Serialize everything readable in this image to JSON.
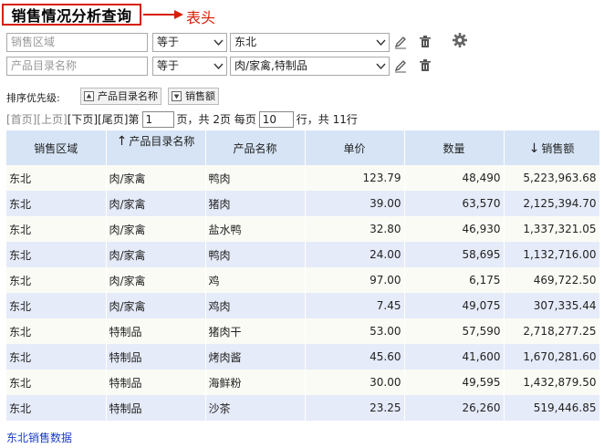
{
  "title": "销售情况分析查询",
  "annotation": {
    "label": "表头",
    "color": "#d81e06"
  },
  "filters": [
    {
      "field_placeholder": "销售区域",
      "operator": "等于",
      "value": "东北"
    },
    {
      "field_placeholder": "产品目录名称",
      "operator": "等于",
      "value": "肉/家禽,特制品"
    }
  ],
  "icons": {
    "edit": "pencil-icon",
    "delete": "trash-icon",
    "settings": "gear-icon"
  },
  "sort": {
    "label": "排序优先级:",
    "buttons": [
      {
        "label": "产品目录名称",
        "direction": "up"
      },
      {
        "label": "销售额",
        "direction": "down"
      }
    ]
  },
  "pager": {
    "first": "[首页]",
    "prev": "[上页]",
    "next": "[下页]",
    "last": "[尾页]",
    "page_prefix": "第",
    "current_page": "1",
    "page_mid": "页，共 2页 每页",
    "page_size": "10",
    "rows_suffix": "行，共 11行"
  },
  "table": {
    "columns": [
      "销售区域",
      "产品目录名称",
      "产品名称",
      "单价",
      "数量",
      "销售额"
    ],
    "sort_arrows": {
      "产品目录名称": "↑",
      "销售额": "↓"
    },
    "rows": [
      [
        "东北",
        "肉/家禽",
        "鸭肉",
        "123.79",
        "48,490",
        "5,223,963.68"
      ],
      [
        "东北",
        "肉/家禽",
        "猪肉",
        "39.00",
        "63,570",
        "2,125,394.70"
      ],
      [
        "东北",
        "肉/家禽",
        "盐水鸭",
        "32.80",
        "46,930",
        "1,337,321.05"
      ],
      [
        "东北",
        "肉/家禽",
        "鸭肉",
        "24.00",
        "58,695",
        "1,132,716.00"
      ],
      [
        "东北",
        "肉/家禽",
        "鸡",
        "97.00",
        "6,175",
        "469,722.50"
      ],
      [
        "东北",
        "肉/家禽",
        "鸡肉",
        "7.45",
        "49,075",
        "307,335.44"
      ],
      [
        "东北",
        "特制品",
        "猪肉干",
        "53.00",
        "57,590",
        "2,718,277.25"
      ],
      [
        "东北",
        "特制品",
        "烤肉酱",
        "45.60",
        "41,600",
        "1,670,281.60"
      ],
      [
        "东北",
        "特制品",
        "海鲜粉",
        "30.00",
        "49,595",
        "1,432,879.50"
      ],
      [
        "东北",
        "特制品",
        "沙茶",
        "23.25",
        "26,260",
        "519,446.85"
      ]
    ]
  },
  "footer": {
    "link": "东北销售数据"
  },
  "colors": {
    "header_bg": "#d6e4f5",
    "row_even": "#e6ebf9",
    "row_odd": "#fbfbf6",
    "link": "#1a3cc4"
  }
}
